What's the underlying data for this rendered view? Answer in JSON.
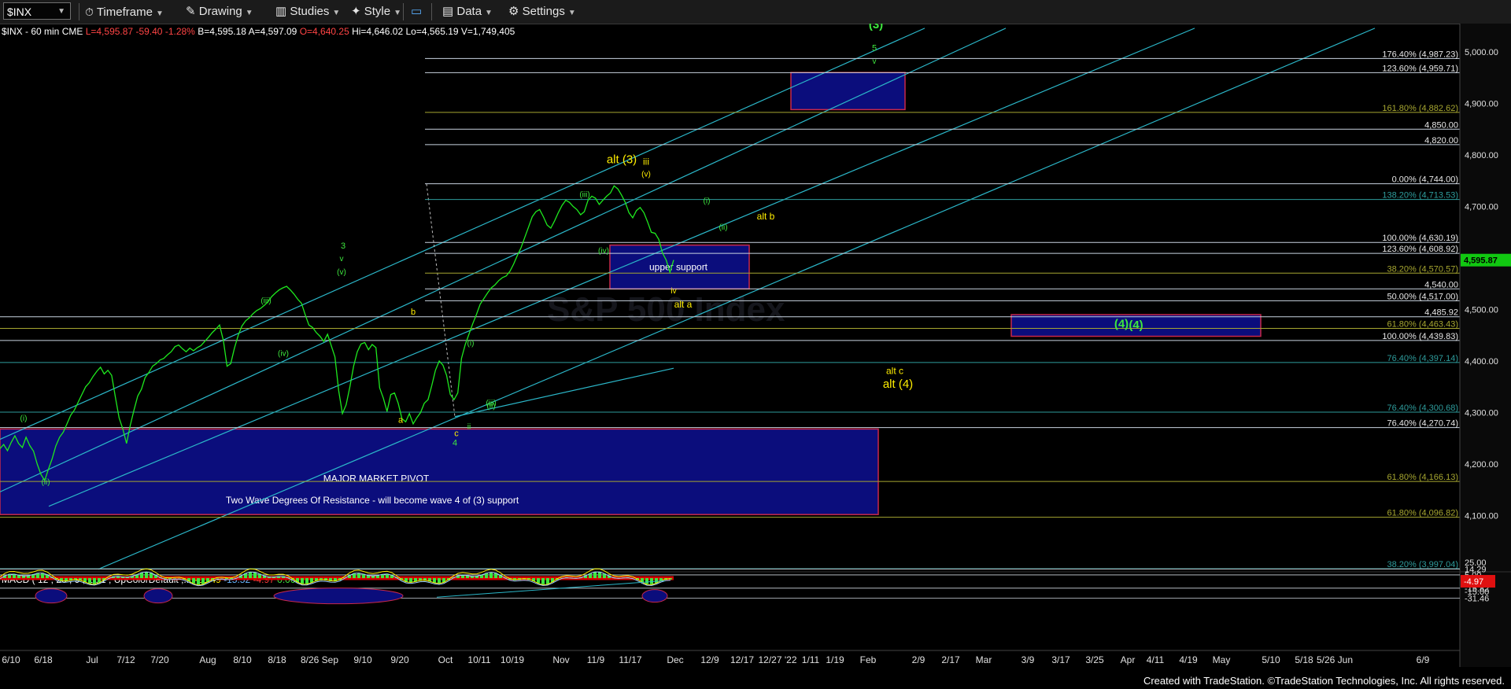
{
  "toolbar": {
    "symbol": "$INX",
    "timeframe_label": "Timeframe",
    "drawing_label": "Drawing",
    "studies_label": "Studies",
    "style_label": "Style",
    "data_label": "Data",
    "settings_label": "Settings"
  },
  "header": {
    "symbol_line": "$INX - 60 min CME",
    "l": "L=4,595.87",
    "chg": "-59.40",
    "pct": "-1.28%",
    "b": "B=4,595.18",
    "a": "A=4,597.09",
    "o": "O=4,640.25",
    "hi": "Hi=4,646.02",
    "lo": "Lo=4,565.19",
    "v": "V=1,749,405"
  },
  "colors": {
    "background": "#000000",
    "price_line": "#1ee81e",
    "channel": "#2bb7c9",
    "level_line": "#c8d3df",
    "fib_box": "#0b0d7c",
    "box_border": "#c8284a",
    "wave_green": "#3ee83e",
    "wave_yellow": "#ffee00",
    "fib_olive": "#a6a630",
    "fib_teal": "#2e9c9c"
  },
  "chart_data": {
    "type": "line",
    "title": "$INX - 60 min CME",
    "ylim": [
      3950,
      5060
    ],
    "y_ticks": [
      "5,000.00",
      "4,900.00",
      "4,800.00",
      "4,700.00",
      "4,600.00",
      "4,500.00",
      "4,400.00",
      "4,300.00",
      "4,200.00",
      "4,100.00"
    ],
    "x_ticks": [
      "6/10",
      "6/18",
      "Jul",
      "7/12",
      "7/20",
      "Aug",
      "8/10",
      "8/18",
      "8/26 Sep",
      "9/10",
      "9/20",
      "Oct",
      "10/11",
      "10/19",
      "Nov",
      "11/9",
      "11/17",
      "Dec",
      "12/9",
      "12/17",
      "12/27 '22",
      "1/11",
      "1/19",
      "Feb",
      "2/9",
      "2/17",
      "Mar",
      "3/9",
      "3/17",
      "3/25",
      "Apr",
      "4/11",
      "4/19",
      "May",
      "5/10",
      "5/18",
      "5/26 Jun",
      "6/9"
    ],
    "last_price": "4,595.87",
    "series": [
      {
        "values": [
          4230,
          4238,
          4226,
          4242,
          4255,
          4240,
          4232,
          4252,
          4236,
          4225,
          4200,
          4180,
          4168,
          4190,
          4210,
          4235,
          4252,
          4262,
          4278,
          4295,
          4305,
          4320,
          4335,
          4350,
          4358,
          4370,
          4380,
          4388,
          4375,
          4382,
          4372,
          4330,
          4290,
          4268,
          4240,
          4275,
          4305,
          4332,
          4345,
          4368,
          4378,
          4390,
          4395,
          4402,
          4405,
          4412,
          4418,
          4428,
          4431,
          4424,
          4418,
          4425,
          4420,
          4426,
          4430,
          4438,
          4446,
          4455,
          4462,
          4470,
          4440,
          4390,
          4395,
          4425,
          4450,
          4468,
          4478,
          4484,
          4492,
          4498,
          4502,
          4508,
          4515,
          4525,
          4532,
          4538,
          4542,
          4545,
          4538,
          4530,
          4520,
          4512,
          4490,
          4470,
          4465,
          4455,
          4448,
          4438,
          4452,
          4430,
          4408,
          4342,
          4298,
          4315,
          4350,
          4390,
          4418,
          4433,
          4436,
          4422,
          4432,
          4426,
          4348,
          4328,
          4302,
          4335,
          4338,
          4318,
          4288,
          4282,
          4298,
          4278,
          4290,
          4300,
          4318,
          4325,
          4352,
          4382,
          4400,
          4392,
          4372,
          4335,
          4325,
          4338,
          4405,
          4432,
          4452,
          4472,
          4490,
          4510,
          4521,
          4532,
          4542,
          4548,
          4556,
          4562,
          4565,
          4574,
          4588,
          4605,
          4620,
          4640,
          4660,
          4680,
          4690,
          4694,
          4680,
          4664,
          4658,
          4672,
          4688,
          4702,
          4712,
          4708,
          4700,
          4694,
          4684,
          4690,
          4712,
          4720,
          4716,
          4704,
          4712,
          4720,
          4726,
          4740,
          4734,
          4722,
          4708,
          4688,
          4678,
          4692,
          4698,
          4688,
          4670,
          4650,
          4648,
          4636,
          4610,
          4596,
          4572,
          4596
        ]
      }
    ],
    "horizontal_levels": [
      {
        "label": "176.40% (4,987.23)",
        "value": 4987.23
      },
      {
        "label": "123.60% (4,959.71)",
        "value": 4959.71
      },
      {
        "label": "161.80% (4,882.62)",
        "value": 4882.62
      },
      {
        "label": "4,850.00",
        "value": 4850.0
      },
      {
        "label": "4,820.00",
        "value": 4820.0
      },
      {
        "label": "0.00% (4,744.00)",
        "value": 4744.0
      },
      {
        "label": "138.20% (4,713.53)",
        "value": 4713.53
      },
      {
        "label": "100.00% (4,630.19)",
        "value": 4630.19
      },
      {
        "label": "123.60% (4,608.92)",
        "value": 4608.92
      },
      {
        "label": "38.20% (4,570.57)",
        "value": 4570.57
      },
      {
        "label": "4,540.00",
        "value": 4540.0
      },
      {
        "label": "50.00% (4,517.00)",
        "value": 4517.0
      },
      {
        "label": "4,485.92",
        "value": 4485.92
      },
      {
        "label": "61.80% (4,463.43)",
        "value": 4463.43
      },
      {
        "label": "100.00% (4,439.83)",
        "value": 4439.83
      },
      {
        "label": "76.40% (4,397.14)",
        "value": 4397.14
      },
      {
        "label": "76.40% (4,300.68)",
        "value": 4300.68
      },
      {
        "label": "76.40% (4,270.74)",
        "value": 4270.74
      },
      {
        "label": "61.80% (4,166.13)",
        "value": 4166.13
      },
      {
        "label": "61.80% (4,096.82)",
        "value": 4096.82
      },
      {
        "label": "38.20% (3,997.04)",
        "value": 3997.04
      }
    ],
    "boxes": [
      {
        "label": "",
        "y_range": [
          4888,
          4960
        ]
      },
      {
        "label": "upper support",
        "y_range": [
          4540,
          4625
        ]
      },
      {
        "label": "(4)",
        "y_range": [
          4448,
          4490
        ]
      },
      {
        "label": "MAJOR MARKET PIVOT",
        "y_range": [
          4102,
          4268
        ]
      }
    ],
    "box_notes": [
      "Two Wave Degrees Of Resistance - will become wave 4 of (3) support"
    ],
    "wave_labels": [
      "(3)",
      "5",
      "v",
      "alt (3)",
      "iii",
      "(v)",
      "(iii)",
      "(i)",
      "(ii)",
      "alt b",
      "(iv)",
      "iv",
      "alt a",
      "(4)",
      "alt c",
      "alt (4)",
      "3",
      "v",
      "(v)",
      "(iii)",
      "(iv)",
      "b",
      "a",
      "c",
      "4",
      "ii",
      "(i)",
      "(ii)",
      "(iii)",
      "(i)",
      "(ii)"
    ],
    "watermarks": [
      "S&P 500 Index"
    ],
    "macd": {
      "label": "MACD ( 12 , 26 , 9 , 1 , 1 , UpColorDefault ,...",
      "values": [
        "-20.49",
        "-15.52",
        "-4.97",
        "0.00"
      ],
      "y_ticks": [
        "25.00",
        "14.29",
        "5.00",
        "-15.82",
        "-15.00",
        "-31.46"
      ],
      "last_value": "-4.97"
    }
  },
  "footer": "Created with TradeStation. ©TradeStation Technologies, Inc. All rights reserved."
}
